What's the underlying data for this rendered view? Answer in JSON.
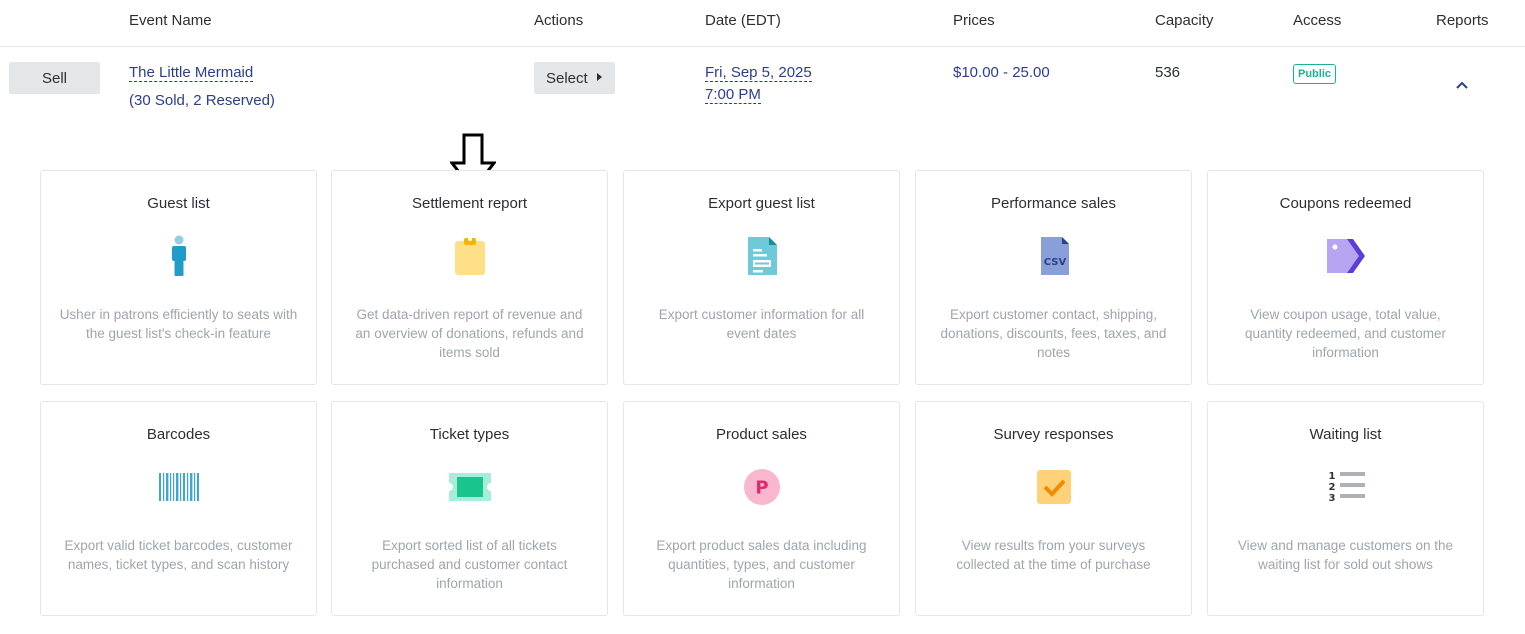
{
  "header": {
    "event_name": "Event Name",
    "actions": "Actions",
    "date": "Date (EDT)",
    "prices": "Prices",
    "capacity": "Capacity",
    "access": "Access",
    "reports": "Reports"
  },
  "event": {
    "sell_label": "Sell",
    "name": "The Little Mermaid",
    "sold_info": "(30 Sold, 2 Reserved)",
    "select_label": "Select",
    "date_line1": "Fri, Sep 5, 2025",
    "date_line2": "7:00 PM",
    "prices": "$10.00 - 25.00",
    "capacity": "536",
    "access_badge": "Public"
  },
  "colors": {
    "link": "#2b3e8c",
    "badge": "#19b394",
    "button_bg": "#e4e6e8",
    "card_border": "#e3e6ea",
    "desc_text": "#9ea6ad"
  },
  "reports": [
    {
      "title": "Guest list",
      "icon": "person-icon",
      "desc": "Usher in patrons efficiently to seats with the guest list's check-in feature"
    },
    {
      "title": "Settlement report",
      "icon": "clipboard-icon",
      "desc": "Get data-driven report of revenue and an overview of donations, refunds and items sold"
    },
    {
      "title": "Export guest list",
      "icon": "document-icon",
      "desc": "Export customer information for all event dates"
    },
    {
      "title": "Performance sales",
      "icon": "csv-file-icon",
      "desc": "Export customer contact, shipping, donations, discounts, fees, taxes, and notes"
    },
    {
      "title": "Coupons redeemed",
      "icon": "tag-icon",
      "desc": "View coupon usage, total value, quantity redeemed, and customer information"
    },
    {
      "title": "Barcodes",
      "icon": "barcode-icon",
      "desc": "Export valid ticket barcodes, customer names, ticket types, and scan history"
    },
    {
      "title": "Ticket types",
      "icon": "ticket-icon",
      "desc": "Export sorted list of all tickets purchased and customer contact information"
    },
    {
      "title": "Product sales",
      "icon": "product-p-icon",
      "desc": "Export product sales data including quantities, types, and customer information"
    },
    {
      "title": "Survey responses",
      "icon": "checkbox-icon",
      "desc": "View results from your surveys collected at the time of purchase"
    },
    {
      "title": "Waiting list",
      "icon": "numbered-list-icon",
      "desc": "View and manage customers on the waiting list for sold out shows"
    }
  ]
}
